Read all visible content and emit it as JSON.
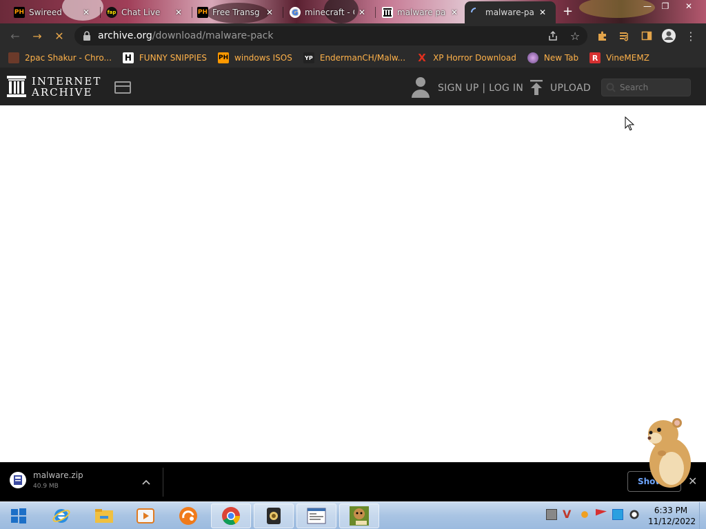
{
  "tabs": [
    {
      "title": "Swireed",
      "favicon": "PH",
      "favicon_color": "#ff9900"
    },
    {
      "title": "Chat Live",
      "favicon": "fap",
      "favicon_color": "#111111"
    },
    {
      "title": "Free Transg",
      "favicon": "PH",
      "favicon_color": "#ff9900"
    },
    {
      "title": "minecraft - G",
      "favicon": "G",
      "favicon_color": "#ffffff"
    },
    {
      "title": "malware pa",
      "favicon": "archive-icon",
      "favicon_color": "#ffffff"
    },
    {
      "title": "malware-pa",
      "favicon": "loading-spinner",
      "favicon_color": "#8ab4f8"
    }
  ],
  "toolbar": {
    "url_host": "archive.org",
    "url_path": "/download/malware-pack"
  },
  "bookmarks": [
    {
      "label": "2pac Shakur - Chro...",
      "icon": "tupac-icon",
      "icon_color": "#c0392b"
    },
    {
      "label": "FUNNY SNIPPIES",
      "icon": "H",
      "icon_color": "#ffffff"
    },
    {
      "label": "windows ISOS",
      "icon": "PH",
      "icon_color": "#ff9900"
    },
    {
      "label": "EndermanCH/Malw...",
      "icon": "YP",
      "icon_color": "#222222"
    },
    {
      "label": "XP Horror Download",
      "icon": "X",
      "icon_color": "#e0301e"
    },
    {
      "label": "New Tab",
      "icon": "globe-icon",
      "icon_color": "#9b59b6"
    },
    {
      "label": "VineMEMZ",
      "icon": "R",
      "icon_color": "#d63031"
    }
  ],
  "ia_header": {
    "logo_line1": "INTERNET",
    "logo_line2": "ARCHIVE",
    "signup": "SIGN UP | LOG IN",
    "upload": "UPLOAD",
    "search_placeholder": "Search"
  },
  "download": {
    "file_name": "malware.zip",
    "file_size": "40.9 MB",
    "show_all": "Show all"
  },
  "taskbar": {
    "time": "6:33 PM",
    "date": "11/12/2022",
    "apps": [
      "internet-explorer-icon",
      "file-explorer-icon",
      "media-player-icon",
      "uc-browser-icon",
      "chrome-icon",
      "app-icon",
      "notepad-icon",
      "bonzi-box-icon"
    ]
  }
}
